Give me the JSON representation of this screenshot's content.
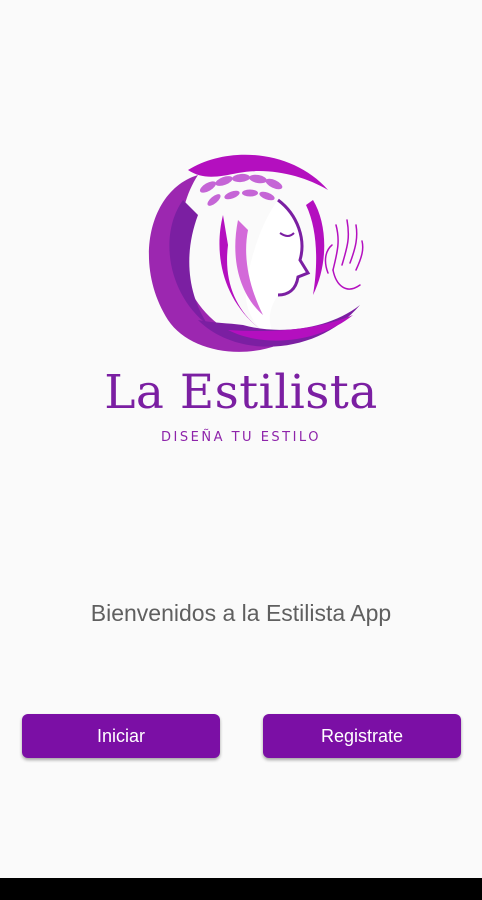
{
  "logo": {
    "brand_name": "La Estilista",
    "tagline": "DISEÑA TU ESTILO",
    "colors": {
      "primary": "#7b1fa2",
      "magenta": "#b40fbf",
      "light_violet": "#c565d6"
    }
  },
  "welcome_text": "Bienvenidos a la Estilista App",
  "buttons": {
    "iniciar_label": "Iniciar",
    "registrate_label": "Registrate",
    "color": "#7b0fa5"
  }
}
